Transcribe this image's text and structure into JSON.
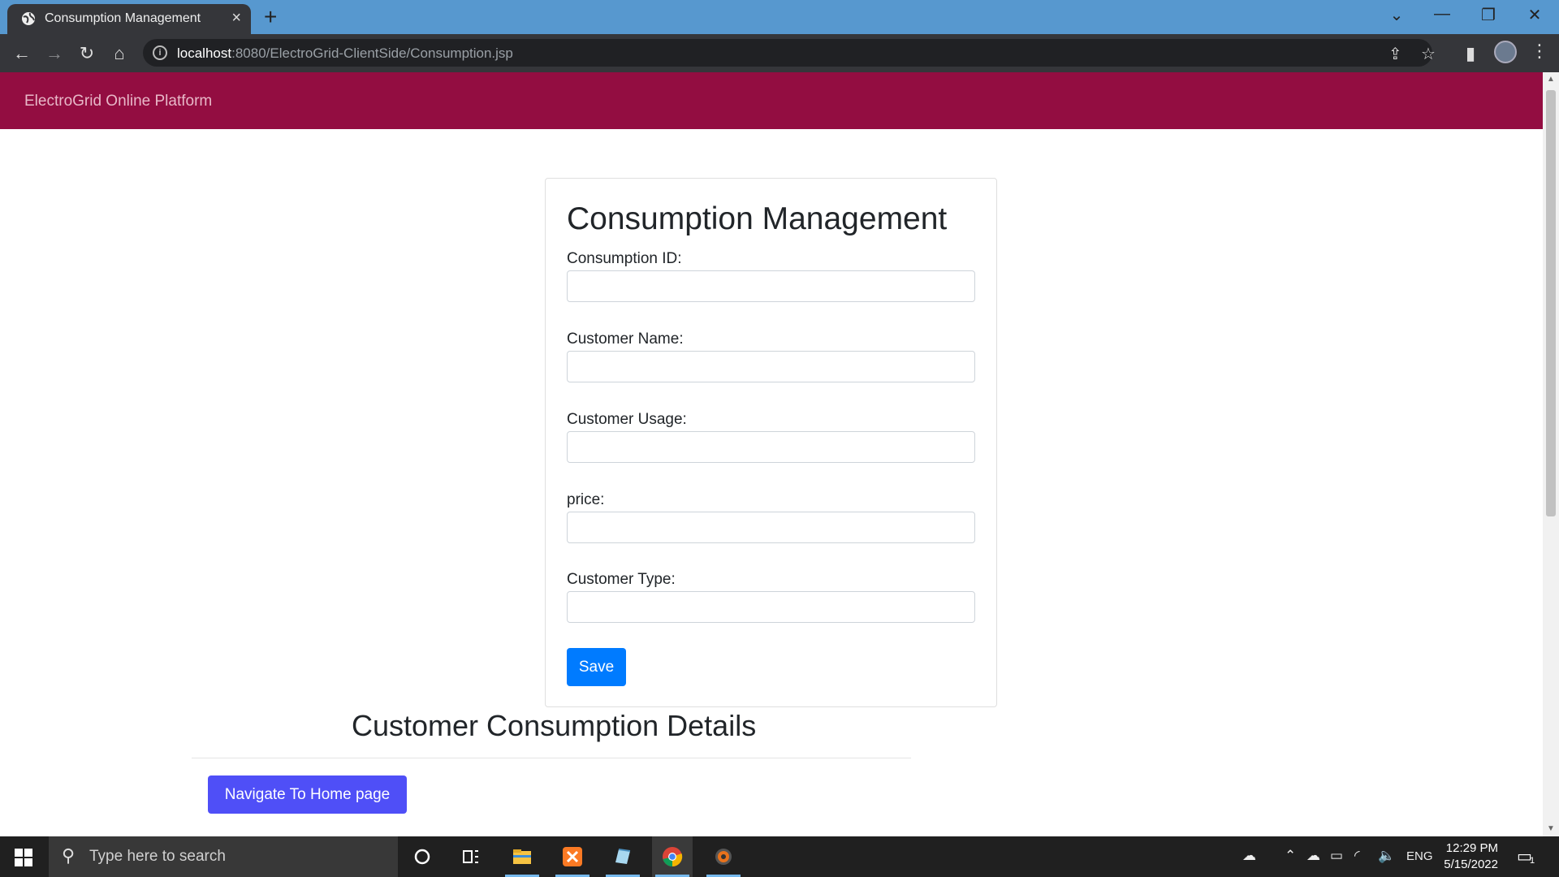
{
  "browser": {
    "tab_title": "Consumption Management",
    "tab_close": "×",
    "new_tab": "+",
    "url_host": "localhost",
    "url_path": ":8080/ElectroGrid-ClientSide/Consumption.jsp",
    "window_controls": {
      "dropdown": "⌄",
      "minimize": "—",
      "restore": "❐",
      "close": "✕"
    }
  },
  "site": {
    "brand": "ElectroGrid Online Platform",
    "brand_color": "#930d41"
  },
  "form": {
    "title": "Consumption Management",
    "fields": [
      {
        "label": "Consumption ID:",
        "value": ""
      },
      {
        "label": "Customer Name:",
        "value": ""
      },
      {
        "label": "Customer Usage:",
        "value": ""
      },
      {
        "label": "price:",
        "value": ""
      },
      {
        "label": "Customer Type:",
        "value": ""
      }
    ],
    "save_label": "Save",
    "save_color": "#007bff"
  },
  "details": {
    "title": "Customer Consumption Details",
    "home_button": "Navigate To Home page",
    "home_button_color": "#4f4ff7"
  },
  "taskbar": {
    "search_placeholder": "Type here to search",
    "language": "ENG",
    "time": "12:29 PM",
    "date": "5/15/2022",
    "notification_count": "1",
    "pinned_apps": [
      "task-view-icon",
      "file-explorer-icon",
      "xampp-icon",
      "notepad-icon",
      "chrome-icon",
      "settings-app-icon"
    ]
  }
}
